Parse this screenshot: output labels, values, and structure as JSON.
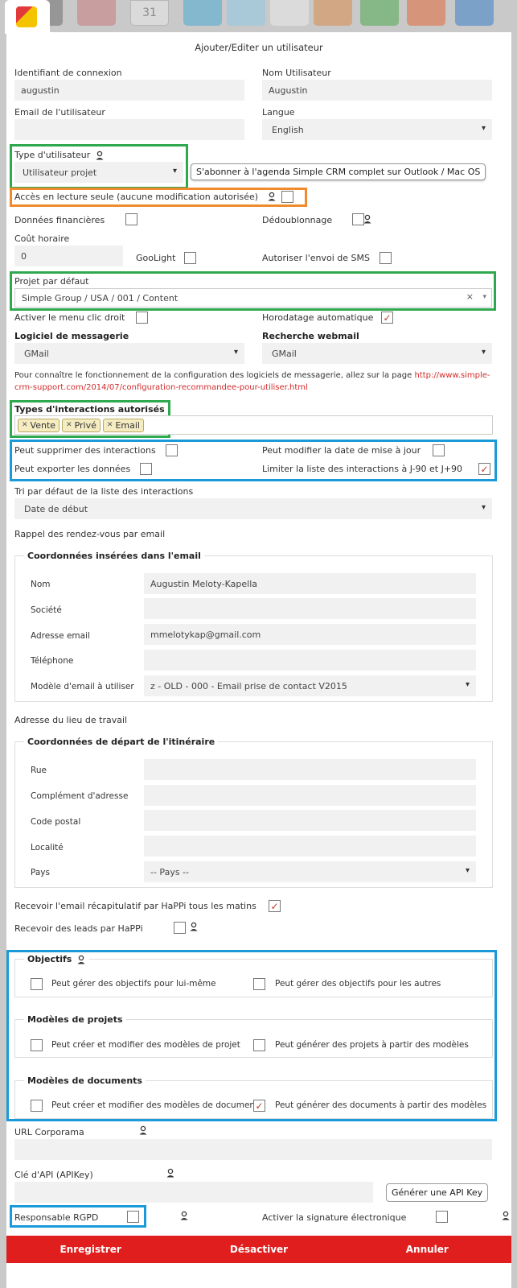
{
  "topbar": {
    "calendar_day": "31",
    "app_icons": [
      "mail-icon",
      "building-icon",
      "calendar-icon",
      "list-icon",
      "search-icon",
      "document-icon",
      "chart-icon",
      "briefcase-icon",
      "tools-icon",
      "help-icon"
    ]
  },
  "modal": {
    "title": "Ajouter/Editer un utilisateur"
  },
  "fields": {
    "login_label": "Identifiant de connexion",
    "login_value": "augustin",
    "username_label": "Nom Utilisateur",
    "username_value": "Augustin",
    "email_label": "Email de l'utilisateur",
    "email_value": "",
    "language_label": "Langue",
    "language_value": "English",
    "user_type_label": "Type d'utilisateur",
    "user_type_value": "Utilisateur projet",
    "subscribe_tooltip": "S'abonner à l'agenda Simple CRM complet sur Outlook / Mac OS",
    "readonly_label": "Accès en lecture seule (aucune modification autorisée)",
    "financial_label": "Données financières",
    "dedup_label": "Dédoublonnage",
    "hourly_cost_label": "Coût horaire",
    "hourly_cost_value": "0",
    "goolight_label": "GooLight",
    "sms_label": "Autoriser l'envoi de SMS",
    "default_project_label": "Projet par défaut",
    "default_project_value": "Simple Group / USA / 001 / Content",
    "right_click_label": "Activer le menu clic droit",
    "timestamp_label": "Horodatage automatique",
    "mail_software_label": "Logiciel de messagerie",
    "mail_software_value": "GMail",
    "webmail_label": "Recherche webmail",
    "webmail_value": "GMail",
    "help_text": "Pour connaître le fonctionnement de la configuration des logiciels de messagerie, allez sur la page",
    "help_link_1": "http://www.simple-",
    "help_link_2": "crm-support.com/2014/07/configuration-recommandee-pour-utiliser.html",
    "interactions_label": "Types d'interactions autorisés",
    "interaction_tags": [
      "Vente",
      "Privé",
      "Email"
    ],
    "can_delete_label": "Peut supprimer des interactions",
    "can_modify_date_label": "Peut modifier la date de mise à jour",
    "can_export_label": "Peut exporter les données",
    "limit_list_label": "Limiter la liste des interactions à J-90 et J+90",
    "sort_label": "Tri par défaut de la liste des interactions",
    "sort_value": "Date de début",
    "reminder_label": "Rappel des rendez-vous par email"
  },
  "email_coords": {
    "legend": "Coordonnées insérées dans l'email",
    "name_label": "Nom",
    "name_value": "Augustin Meloty-Kapella",
    "company_label": "Société",
    "company_value": "",
    "email_label": "Adresse email",
    "email_value": "mmelotykap@gmail.com",
    "phone_label": "Téléphone",
    "phone_value": "",
    "template_label": "Modèle d'email à utiliser",
    "template_value": "z - OLD - 000 - Email prise de contact V2015"
  },
  "workplace": {
    "label": "Adresse du lieu de travail",
    "legend": "Coordonnées de départ de l'itinéraire",
    "street_label": "Rue",
    "complement_label": "Complément d'adresse",
    "postal_label": "Code postal",
    "city_label": "Localité",
    "country_label": "Pays",
    "country_value": "-- Pays --"
  },
  "daily_email_label": "Recevoir l'email récapitulatif par HaPPi tous les matins",
  "leads_label": "Recevoir des leads par HaPPi",
  "objectives": {
    "legend": "Objectifs",
    "self_label": "Peut gérer des objectifs pour lui-même",
    "others_label": "Peut gérer des objectifs pour les autres"
  },
  "project_models": {
    "legend": "Modèles de projets",
    "edit_label": "Peut créer et modifier des modèles de projet",
    "generate_label": "Peut générer des projets à partir des modèles"
  },
  "document_models": {
    "legend": "Modèles de documents",
    "edit_label": "Peut créer et modifier des modèles de document",
    "generate_label": "Peut générer des documents à partir des modèles"
  },
  "corporama_label": "URL Corporama",
  "apikey_label": "Clé d'API (APIKey)",
  "generate_api_label": "Générer une API Key",
  "rgpd_label": "Responsable RGPD",
  "esign_label": "Activer la signature électronique",
  "footer": {
    "save": "Enregistrer",
    "deactivate": "Désactiver",
    "cancel": "Annuler"
  },
  "checkboxes": {
    "readonly": false,
    "financial": false,
    "dedup": false,
    "goolight": false,
    "sms": false,
    "right_click": false,
    "timestamp": true,
    "can_delete": false,
    "can_modify_date": false,
    "can_export": false,
    "limit_list": true,
    "daily_email": true,
    "leads": false,
    "obj_self": false,
    "obj_others": false,
    "proj_edit": false,
    "proj_generate": false,
    "doc_edit": false,
    "doc_generate": true,
    "rgpd": false,
    "esign": false
  },
  "colors": {
    "footer": "#e01e1e",
    "frame_green": "#2fa94f",
    "frame_orange": "#f08a2c",
    "frame_blue": "#1a9ad8",
    "check": "#c0392b"
  }
}
